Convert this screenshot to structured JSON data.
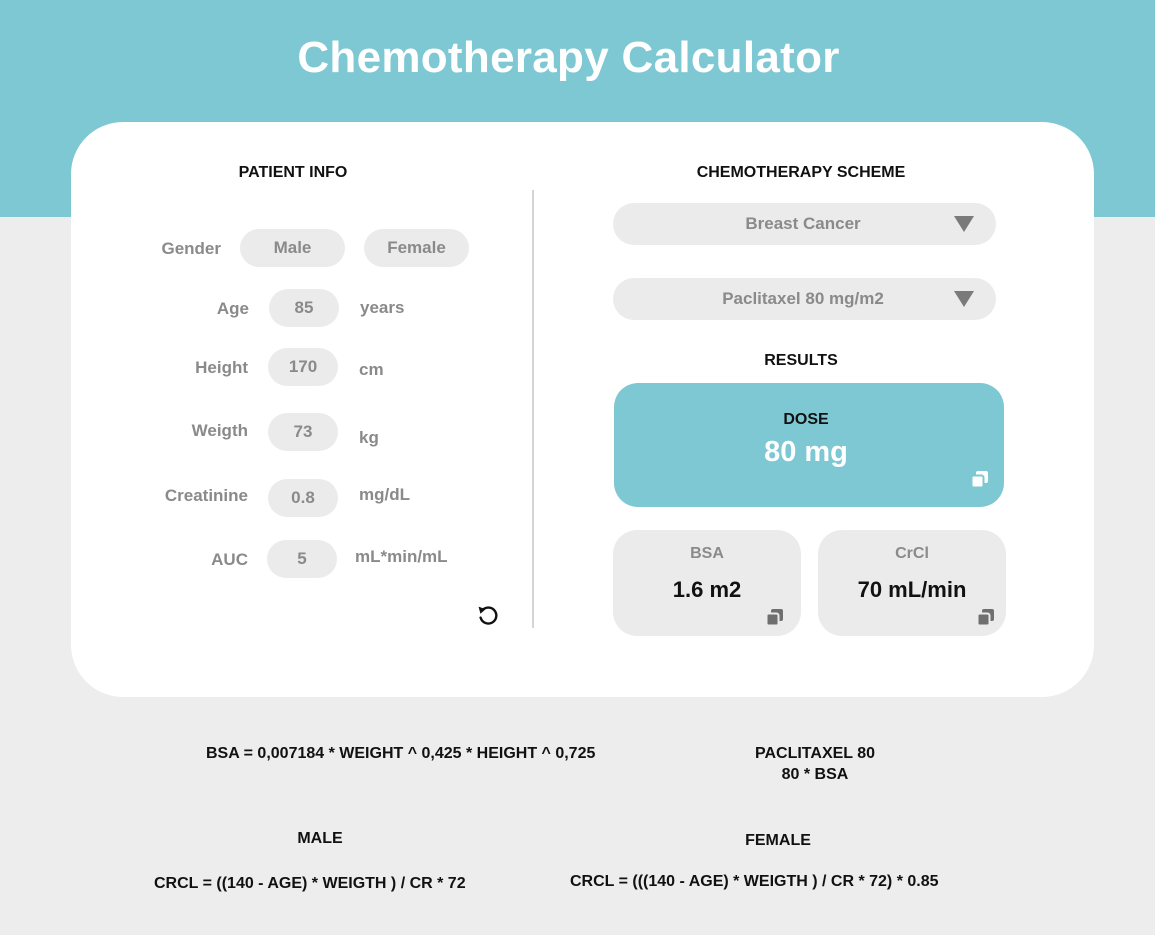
{
  "header": {
    "title": "Chemotherapy Calculator"
  },
  "patient_info": {
    "title": "PATIENT INFO",
    "gender": {
      "label": "Gender",
      "options": [
        "Male",
        "Female"
      ]
    },
    "age": {
      "label": "Age",
      "value": "85",
      "unit": "years"
    },
    "height": {
      "label": "Height",
      "value": "170",
      "unit": "cm"
    },
    "weight": {
      "label": "Weigth",
      "value": "73",
      "unit": "kg"
    },
    "creatinine": {
      "label": "Creatinine",
      "value": "0.8",
      "unit": "mg/dL"
    },
    "auc": {
      "label": "AUC",
      "value": "5",
      "unit": "mL*min/mL"
    },
    "reset_icon": "reset-icon"
  },
  "scheme": {
    "title": "CHEMOTHERAPY SCHEME",
    "cancer_select": "Breast Cancer",
    "drug_select": "Paclitaxel 80 mg/m2"
  },
  "results": {
    "title": "RESULTS",
    "dose": {
      "label": "DOSE",
      "value": "80 mg"
    },
    "bsa": {
      "label": "BSA",
      "value": "1.6 m2"
    },
    "crcl": {
      "label": "CrCl",
      "value": "70 mL/min"
    }
  },
  "formulas": {
    "bsa": "BSA = 0,007184 * WEIGHT ^ 0,425 * HEIGHT ^ 0,725",
    "drug_name": "PACLITAXEL 80",
    "drug_formula": "80 * BSA",
    "male_title": "MALE",
    "male_formula": "CRCL = ((140 - AGE) * WEIGTH ) / CR * 72",
    "female_title": "FEMALE",
    "female_formula": "CRCL = (((140 - AGE) * WEIGTH ) / CR * 72) * 0.85"
  },
  "colors": {
    "accent": "#7dc8d3",
    "pill": "#ebebeb",
    "muted_text": "#8a8a8a",
    "background": "#ededed"
  }
}
